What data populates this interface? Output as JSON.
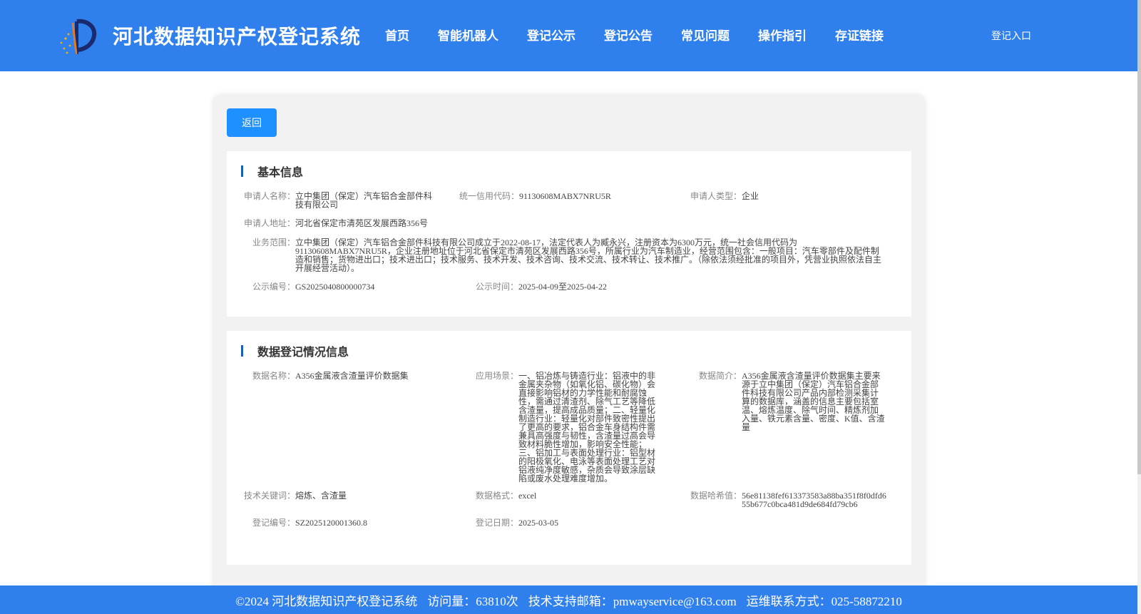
{
  "header": {
    "site_title": "河北数据知识产权登记系统",
    "nav": [
      "首页",
      "智能机器人",
      "登记公示",
      "登记公告",
      "常见问题",
      "操作指引",
      "存证链接"
    ],
    "login_label": "登记入口",
    "bg_color": "#2f80ed"
  },
  "main": {
    "back_label": "返回",
    "basic": {
      "title": "基本信息",
      "applicant_name_label": "申请人名称：",
      "applicant_name": "立中集团（保定）汽车铝合金部件科技有限公司",
      "credit_code_label": "统一信用代码：",
      "credit_code": "91130608MABX7NRU5R",
      "applicant_type_label": "申请人类型：",
      "applicant_type": "企业",
      "address_label": "申请人地址：",
      "address": "河北省保定市清苑区发展西路356号",
      "business_label": "业务范围：",
      "business": "立中集团（保定）汽车铝合金部件科技有限公司成立于2022-08-17，法定代表人为臧永兴，注册资本为6300万元，统一社会信用代码为91130608MABX7NRU5R，企业注册地址位于河北省保定市清苑区发展西路356号，所属行业为汽车制造业，经营范围包含：一般项目：汽车零部件及配件制造和销售；货物进出口；技术进出口；技术服务、技术开发、技术咨询、技术交流、技术转让、技术推广。（除依法须经批准的项目外，凭营业执照依法自主开展经营活动）。",
      "pub_no_label": "公示编号：",
      "pub_no": "GS2025040800000734",
      "pub_time_label": "公示时间：",
      "pub_time": "2025-04-09至2025-04-22"
    },
    "data_reg": {
      "title": "数据登记情况信息",
      "data_name_label": "数据名称：",
      "data_name": "A356金属液含渣量评价数据集",
      "scenario_label": "应用场景：",
      "scenario": "一、铝冶炼与铸造行业：铝液中的非金属夹杂物（如氧化铝、碳化物）会直接影响铝材的力学性能和耐腐蚀性，需通过清渣剂、除气工艺等降低含渣量，提高成品质量；二、轻量化制造行业：轻量化对部件致密性提出了更高的要求，铝合金车身结构件需兼具高强度与韧性，含渣量过高会导致材料脆性增加，影响安全性能；三、铝加工与表面处理行业：铝型材的阳极氧化、电泳等表面处理工艺对铝液纯净度敏感，杂质会导致涂层缺陷或废水处理难度增加。",
      "intro_label": "数据简介：",
      "intro": "A356金属液含渣量评价数据集主要来源于立中集团（保定）汽车铝合金部件科技有限公司产品内部检测采集计算的数据库，涵盖的信息主要包括室温、熔炼温度、除气时间、精炼剂加入量、铁元素含量、密度、K值、含渣量",
      "keywords_label": "技术关键词：",
      "keywords": "熔炼、含渣量",
      "format_label": "数据格式：",
      "format": "excel",
      "hash_label": "数据哈希值：",
      "hash": "56e81138fef613373583a88ba351f8f0dfd655b677c0bca481d9de684fd79cb6",
      "reg_no_label": "登记编号：",
      "reg_no": "SZ2025120001360.8",
      "reg_date_label": "登记日期：",
      "reg_date": "2025-03-05"
    }
  },
  "footer": {
    "copyright": "©2024 河北数据知识产权登记系统",
    "visits": "访问量：63810次",
    "email": "技术支持邮箱：pmwayservice@163.com",
    "phone": "运维联系方式：025-58872210"
  }
}
